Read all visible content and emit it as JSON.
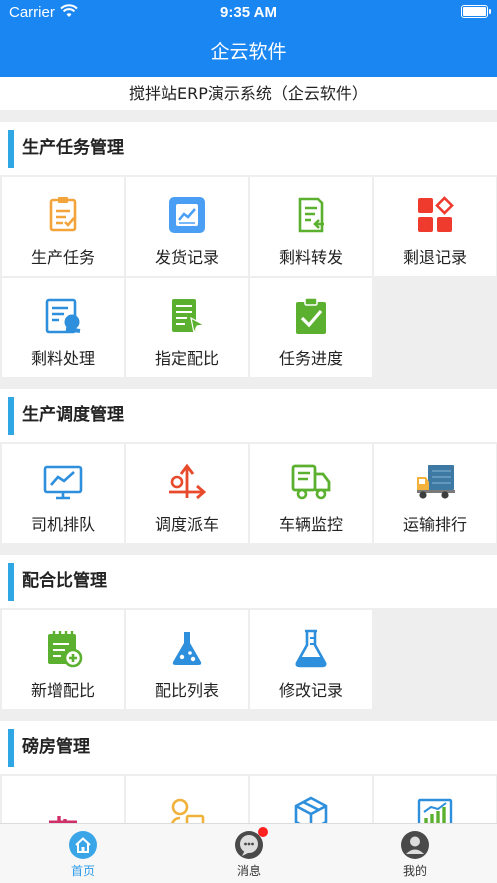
{
  "status_bar": {
    "carrier": "Carrier",
    "time": "9:35 AM"
  },
  "nav": {
    "title": "企云软件"
  },
  "subtitle": "搅拌站ERP演示系统（企云软件）",
  "sections": [
    {
      "title": "生产任务管理",
      "items": [
        {
          "label": "生产任务",
          "icon": "task-list-icon"
        },
        {
          "label": "发货记录",
          "icon": "shipping-chart-icon"
        },
        {
          "label": "剩料转发",
          "icon": "document-forward-icon"
        },
        {
          "label": "剩退记录",
          "icon": "grid-blocks-icon"
        },
        {
          "label": "剩料处理",
          "icon": "document-process-icon"
        },
        {
          "label": "指定配比",
          "icon": "document-cursor-icon"
        },
        {
          "label": "任务进度",
          "icon": "clipboard-check-icon"
        }
      ]
    },
    {
      "title": "生产调度管理",
      "items": [
        {
          "label": "司机排队",
          "icon": "monitor-chart-icon"
        },
        {
          "label": "调度派车",
          "icon": "dispatch-arrows-icon"
        },
        {
          "label": "车辆监控",
          "icon": "truck-monitor-icon"
        },
        {
          "label": "运输排行",
          "icon": "delivery-truck-icon"
        }
      ]
    },
    {
      "title": "配合比管理",
      "items": [
        {
          "label": "新增配比",
          "icon": "notepad-add-icon"
        },
        {
          "label": "配比列表",
          "icon": "flask-icon"
        },
        {
          "label": "修改记录",
          "icon": "beaker-icon"
        }
      ]
    },
    {
      "title": "磅房管理",
      "items": [
        {
          "label": "",
          "icon": "bars-icon"
        },
        {
          "label": "",
          "icon": "person-truck-icon"
        },
        {
          "label": "",
          "icon": "package-box-icon"
        },
        {
          "label": "",
          "icon": "chart-board-icon"
        }
      ]
    }
  ],
  "tabbar": {
    "items": [
      {
        "label": "首页",
        "icon": "home-icon",
        "active": true
      },
      {
        "label": "消息",
        "icon": "message-icon",
        "badge": true
      },
      {
        "label": "我的",
        "icon": "profile-icon"
      }
    ]
  },
  "colors": {
    "primary": "#1a86f2",
    "section_bar": "#30a7e5",
    "tab_active": "#2f9be8",
    "badge": "#ff2020"
  }
}
